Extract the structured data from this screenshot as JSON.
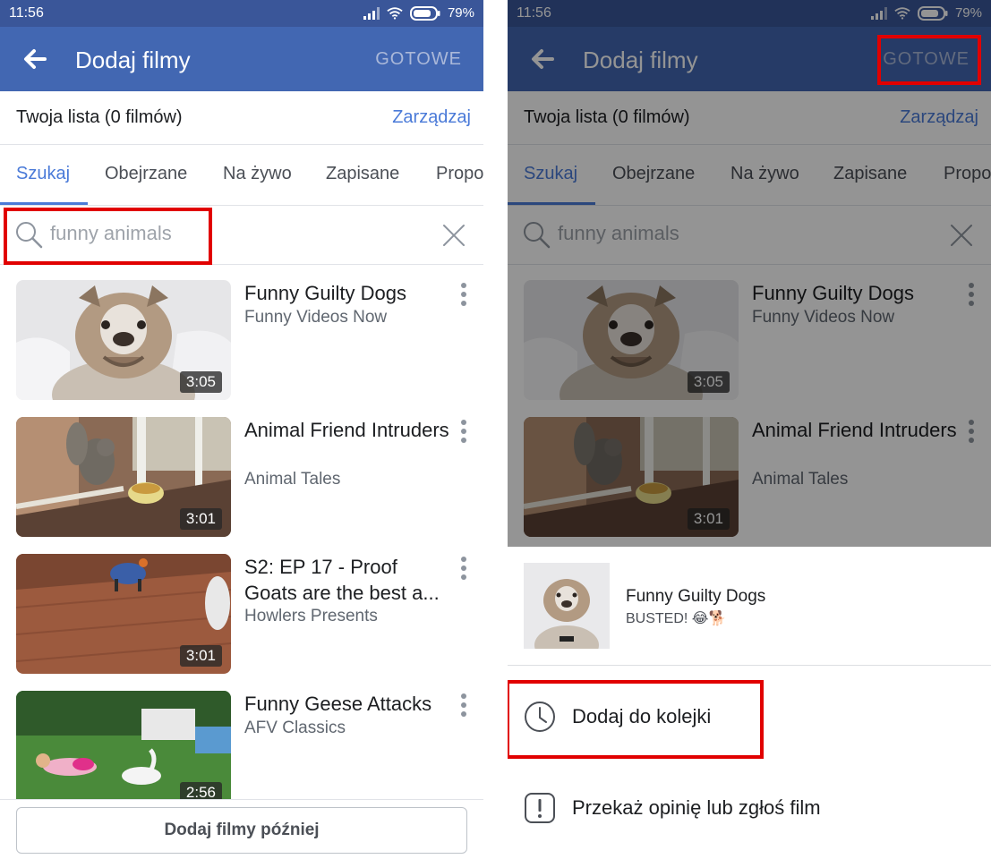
{
  "status": {
    "time": "11:56",
    "battery": "79%"
  },
  "app_bar": {
    "title": "Dodaj filmy",
    "done_label": "GOTOWE"
  },
  "list": {
    "label": "Twoja lista (0 filmów)",
    "manage_label": "Zarządzaj"
  },
  "tabs": [
    "Szukaj",
    "Obejrzane",
    "Na żywo",
    "Zapisane",
    "Propo"
  ],
  "active_tab": "Szukaj",
  "search": {
    "value": "funny animals"
  },
  "videos": [
    {
      "title": "Funny Guilty Dogs",
      "channel": "Funny Videos Now",
      "duration": "3:05"
    },
    {
      "title": "Animal Friend Intruders",
      "channel": "Animal Tales",
      "duration": "3:01"
    },
    {
      "title": "S2: EP 17 - Proof Goats are the best a...",
      "channel": "Howlers Presents",
      "duration": "3:01"
    },
    {
      "title": "Funny Geese Attacks",
      "channel": "AFV Classics",
      "duration": "2:56"
    }
  ],
  "later_button": "Dodaj filmy później",
  "sheet": {
    "title": "Funny Guilty Dogs",
    "subtitle": "BUSTED! 😂🐕",
    "items": [
      {
        "label": "Dodaj do kolejki",
        "icon": "clock-icon"
      },
      {
        "label": "Przekaż opinię lub zgłoś film",
        "icon": "report-icon"
      }
    ]
  },
  "colors": {
    "status_bar": "#3a5699",
    "app_bar": "#4267b2",
    "accent": "#4a7ad8",
    "highlight": "#e10000"
  }
}
